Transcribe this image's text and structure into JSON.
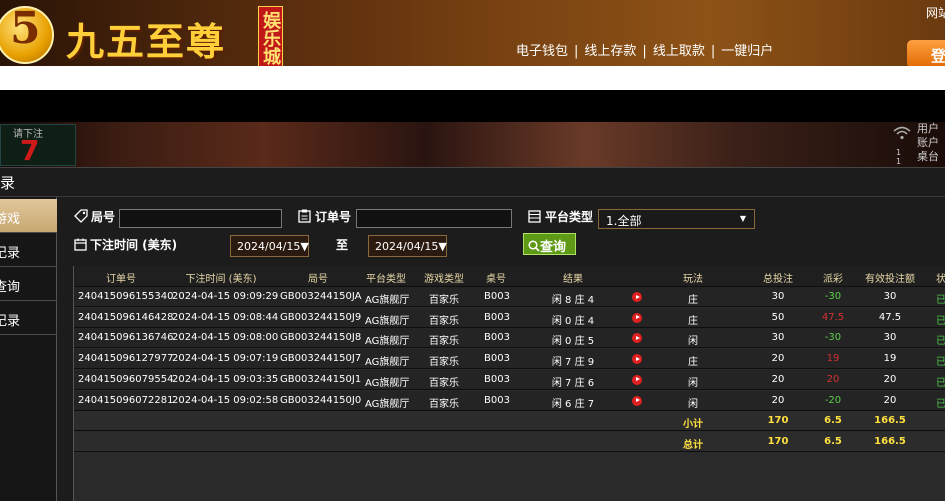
{
  "header": {
    "logo_mark": "5",
    "logo_text": "九五至尊",
    "logo_badge": "娱乐城",
    "links": [
      "电子钱包",
      "线上存款",
      "线上取款",
      "一键归户"
    ],
    "link_separator": "|",
    "top_right_text": "网站",
    "login_label": "登"
  },
  "game_strip": {
    "label": "请下注",
    "big_number": "7",
    "right_lines": [
      "用户",
      "账户",
      "桌台"
    ],
    "small_numbers": [
      "1",
      "1"
    ]
  },
  "panel": {
    "title": "录"
  },
  "sidebar": {
    "items": [
      {
        "label": "游戏",
        "active": true
      },
      {
        "label": "记录",
        "active": false
      },
      {
        "label": "查询",
        "active": false
      },
      {
        "label": "记录",
        "active": false
      }
    ]
  },
  "filters": {
    "round_label": "局号",
    "order_label": "订单号",
    "platform_label": "平台类型",
    "platform_value": "1.全部",
    "time_label": "下注时间 (美东)",
    "date_from": "2024/04/15",
    "date_to": "2024/04/15",
    "to_label": "至",
    "query_label": "查询"
  },
  "table": {
    "headers": [
      "订单号",
      "下注时间 (美东)",
      "局号",
      "平台类型",
      "游戏类型",
      "桌号",
      "结果",
      "玩法",
      "总投注",
      "派彩",
      "有效投注额",
      "状态"
    ],
    "rows": [
      {
        "order": "240415096155340",
        "time": "2024-04-15 09:09:29",
        "round": "GB003244150JA",
        "platform": "AG旗舰厅",
        "game": "百家乐",
        "table": "B003",
        "result": "闲 8 庄 4",
        "play": "庄",
        "bet": "30",
        "payout": "-30",
        "payout_sign": "pos",
        "valid": "30",
        "status": "已派"
      },
      {
        "order": "240415096146428",
        "time": "2024-04-15 09:08:44",
        "round": "GB003244150J9",
        "platform": "AG旗舰厅",
        "game": "百家乐",
        "table": "B003",
        "result": "闲 0 庄 4",
        "play": "庄",
        "bet": "50",
        "payout": "47.5",
        "payout_sign": "neg",
        "valid": "47.5",
        "status": "已派"
      },
      {
        "order": "240415096136746",
        "time": "2024-04-15 09:08:00",
        "round": "GB003244150J8",
        "platform": "AG旗舰厅",
        "game": "百家乐",
        "table": "B003",
        "result": "闲 0 庄 5",
        "play": "闲",
        "bet": "30",
        "payout": "-30",
        "payout_sign": "pos",
        "valid": "30",
        "status": "已派"
      },
      {
        "order": "240415096127977",
        "time": "2024-04-15 09:07:19",
        "round": "GB003244150J7",
        "platform": "AG旗舰厅",
        "game": "百家乐",
        "table": "B003",
        "result": "闲 7 庄 9",
        "play": "庄",
        "bet": "20",
        "payout": "19",
        "payout_sign": "neg",
        "valid": "19",
        "status": "已派"
      },
      {
        "order": "240415096079554",
        "time": "2024-04-15 09:03:35",
        "round": "GB003244150J1",
        "platform": "AG旗舰厅",
        "game": "百家乐",
        "table": "B003",
        "result": "闲 7 庄 6",
        "play": "闲",
        "bet": "20",
        "payout": "20",
        "payout_sign": "neg",
        "valid": "20",
        "status": "已派"
      },
      {
        "order": "240415096072281",
        "time": "2024-04-15 09:02:58",
        "round": "GB003244150J0",
        "platform": "AG旗舰厅",
        "game": "百家乐",
        "table": "B003",
        "result": "闲 6 庄 7",
        "play": "闲",
        "bet": "20",
        "payout": "-20",
        "payout_sign": "pos",
        "valid": "20",
        "status": "已派"
      }
    ],
    "subtotal": {
      "label": "小计",
      "bet": "170",
      "payout": "6.5",
      "valid": "166.5"
    },
    "total": {
      "label": "总计",
      "bet": "170",
      "payout": "6.5",
      "valid": "166.5"
    }
  },
  "colors": {
    "accent_gold": "#ffe040",
    "payout_positive": "#5bd14a",
    "payout_negative": "#d43030",
    "query_button": "#5f9a16",
    "active_tab": "#d8bc8a"
  }
}
